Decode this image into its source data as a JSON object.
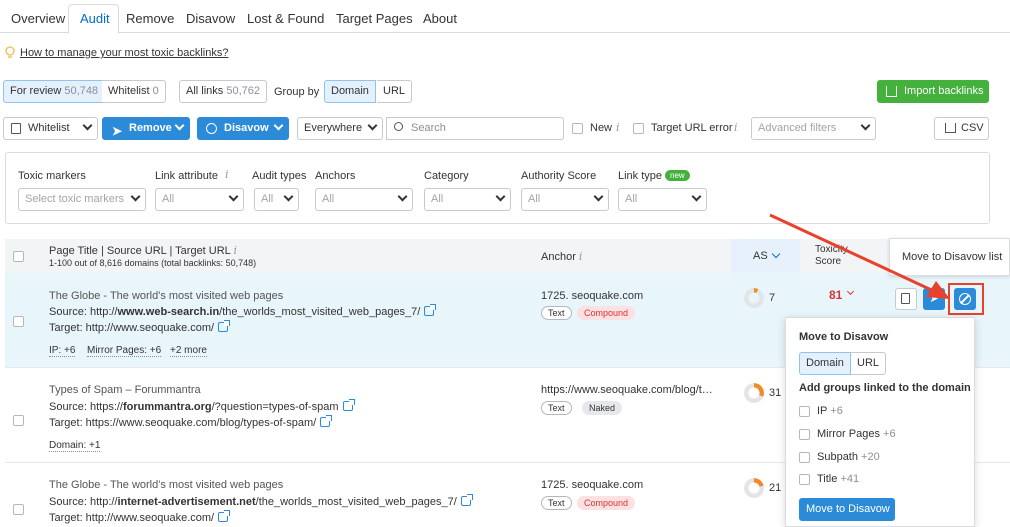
{
  "tabs": [
    "Overview",
    "Audit",
    "Remove",
    "Disavow",
    "Lost & Found",
    "Target Pages",
    "About"
  ],
  "help_link": "How to manage your most toxic backlinks?",
  "status_bar": {
    "for_review_label": "For review",
    "for_review_count": "50,748",
    "whitelist_label": "Whitelist",
    "whitelist_count": "0",
    "all_links_label": "All links",
    "all_links_count": "50,762",
    "group_by_label": "Group by",
    "group_domain": "Domain",
    "group_url": "URL",
    "import_label": "Import backlinks"
  },
  "toolbar": {
    "whitelist": "Whitelist",
    "remove": "Remove",
    "disavow": "Disavow",
    "everywhere": "Everywhere",
    "search_placeholder": "Search",
    "new_label": "New",
    "target_error_label": "Target URL error",
    "advanced_filters": "Advanced filters",
    "csv": "CSV",
    "info_glyph": "i"
  },
  "filters": {
    "toxic_markers_label": "Toxic markers",
    "toxic_markers_placeholder": "Select toxic markers",
    "link_attr_label": "Link attribute",
    "audit_types_label": "Audit types",
    "anchors_label": "Anchors",
    "category_label": "Category",
    "authority_label": "Authority Score",
    "link_type_label": "Link type",
    "new_badge": "new",
    "all": "All"
  },
  "table_header": {
    "title": "Page Title | Source URL | Target URL",
    "subtitle": "1-100 out of 8,616 domains (total backlinks: 50,748)",
    "anchor": "Anchor",
    "as": "AS",
    "toxicity_line1": "Toxicity",
    "toxicity_line2": "Score"
  },
  "rows": [
    {
      "title": "The Globe - The world's most visited web pages",
      "source_prefix": "Source: http://",
      "source_domain": "www.web-search.in",
      "source_path": "/the_worlds_most_visited_web_pages_7/",
      "target": "Target: http://www.seoquake.com/",
      "meta1": "IP: +6",
      "meta2": "Mirror Pages: +6",
      "meta3": "+2 more",
      "anchor": "1725. seoquake.com",
      "tag1": "Text",
      "tag2": "Compound",
      "as": "7",
      "as_fraction": 0.07,
      "toxic": "81"
    },
    {
      "title": "Types of Spam – Forummantra",
      "source_prefix": "Source: https://",
      "source_domain": "forummantra.org",
      "source_path": "/?question=types-of-spam",
      "target": "Target: https://www.seoquake.com/blog/types-of-spam/",
      "meta1": "Domain: +1",
      "anchor": "https://www.seoquake.com/blog/t…",
      "tag1": "Text",
      "tag2": "Naked",
      "as": "31",
      "as_fraction": 0.31
    },
    {
      "title": "The Globe - The world's most visited web pages",
      "source_prefix": "Source: http://",
      "source_domain": "internet-advertisement.net",
      "source_path": "/the_worlds_most_visited_web_pages_7/",
      "target": "Target: http://www.seoquake.com/",
      "anchor": "1725. seoquake.com",
      "tag1": "Text",
      "tag2": "Compound",
      "as": "21",
      "as_fraction": 0.21
    }
  ],
  "tooltip": "Move to Disavow list",
  "disavow_menu": {
    "title": "Move to Disavow",
    "domain": "Domain",
    "url": "URL",
    "groups_title": "Add groups linked to the domain",
    "options": [
      {
        "label": "IP",
        "count": "+6"
      },
      {
        "label": "Mirror Pages",
        "count": "+6"
      },
      {
        "label": "Subpath",
        "count": "+20"
      },
      {
        "label": "Title",
        "count": "+41"
      }
    ],
    "button": "Move to Disavow"
  },
  "colors": {
    "accent": "#2b8bd9",
    "danger": "#d53535",
    "success": "#44b13d",
    "annotation": "#e8412c"
  }
}
